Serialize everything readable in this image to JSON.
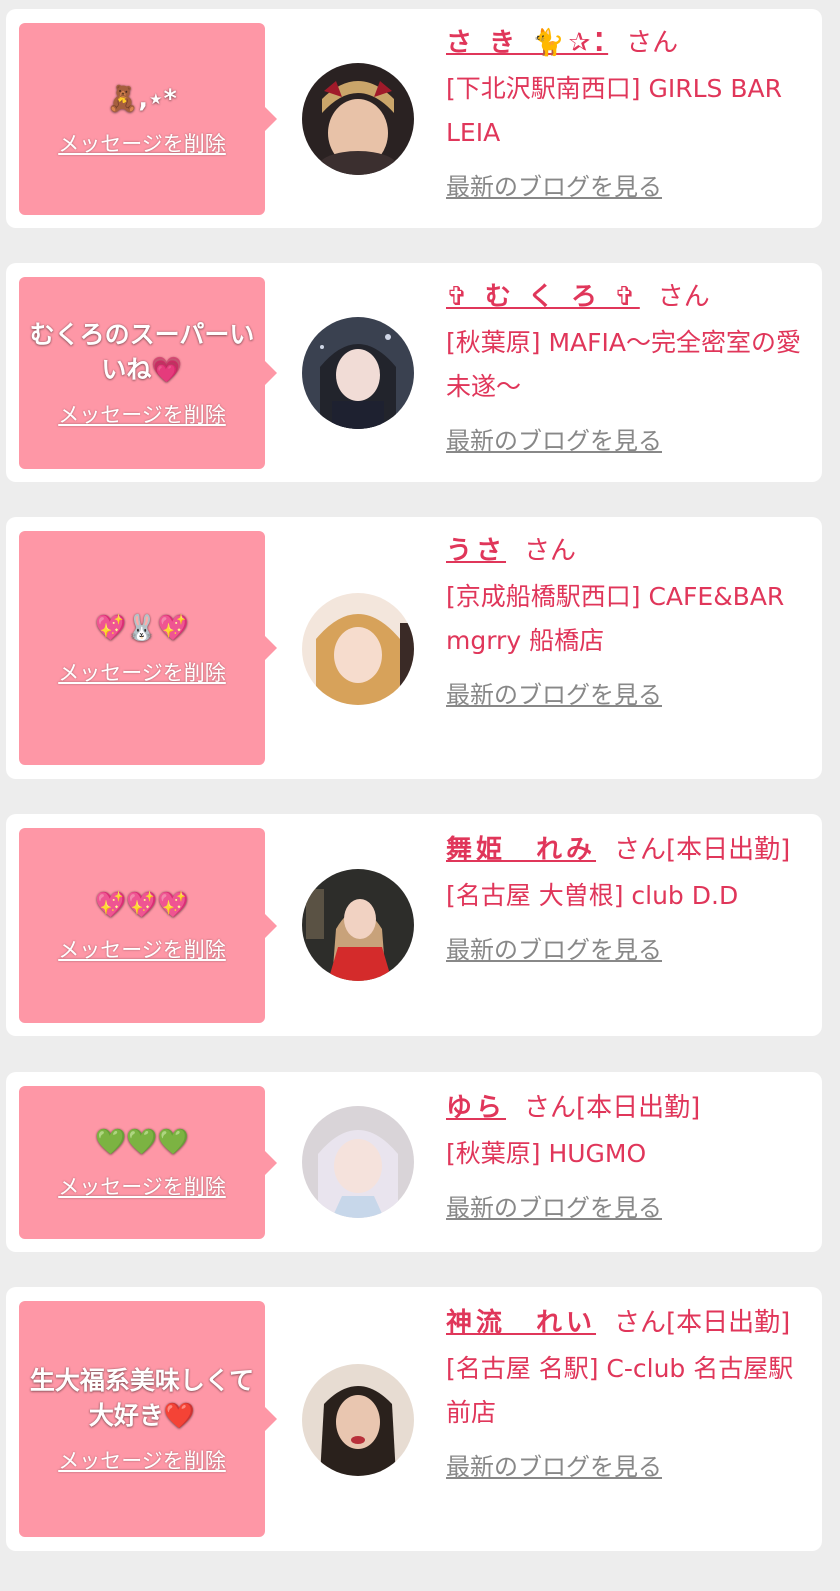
{
  "accent_color": "#e0365a",
  "bubble_color": "#fe97a6",
  "messages": [
    {
      "message": "🧸,⋆*",
      "delete_label": "メッセージを削除",
      "name": "さ き 🐈✰⁚",
      "suffix": "さん",
      "shop": "[下北沢駅南西口] GIRLS BAR LEIA",
      "blog_label": "最新のブログを見る",
      "avatar_icon": "avatar-photo-icon"
    },
    {
      "message": "むくろのスーパーいいね💗",
      "delete_label": "メッセージを削除",
      "name": "✞ む く ろ ✞",
      "suffix": "さん",
      "shop": "[秋葉原] MAFIA〜完全密室の愛未遂〜",
      "blog_label": "最新のブログを見る",
      "avatar_icon": "avatar-photo-icon"
    },
    {
      "message": "💖🐰💖",
      "delete_label": "メッセージを削除",
      "name": "うさ",
      "suffix": "さん",
      "shop": "[京成船橋駅西口] CAFE&BAR mgrry 船橋店",
      "blog_label": "最新のブログを見る",
      "avatar_icon": "avatar-photo-icon"
    },
    {
      "message": "💖💖💖",
      "delete_label": "メッセージを削除",
      "name": "舞姫　れみ",
      "suffix": "さん[本日出勤]",
      "shop": "[名古屋 大曽根] club D.D",
      "blog_label": "最新のブログを見る",
      "avatar_icon": "avatar-photo-icon"
    },
    {
      "message": "💚💚💚",
      "delete_label": "メッセージを削除",
      "name": "ゆら",
      "suffix": "さん[本日出勤]",
      "shop": "[秋葉原] HUGMO",
      "blog_label": "最新のブログを見る",
      "avatar_icon": "avatar-photo-icon"
    },
    {
      "message": "生大福系美味しくて大好き❤️",
      "delete_label": "メッセージを削除",
      "name": "神流　れい",
      "suffix": "さん[本日出勤]",
      "shop": "[名古屋 名駅] C-club 名古屋駅前店",
      "blog_label": "最新のブログを見る",
      "avatar_icon": "avatar-photo-icon"
    }
  ]
}
